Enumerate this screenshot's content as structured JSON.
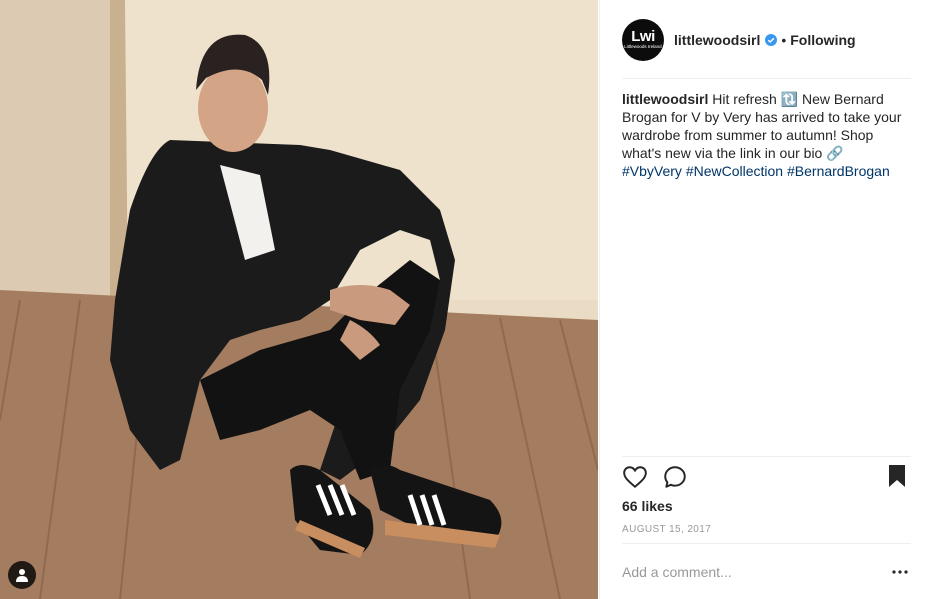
{
  "post": {
    "username": "littlewoodsirl",
    "separator": "•",
    "follow_label": "Following",
    "avatar_text": "Lwi",
    "avatar_subtext": "Littlewoods Ireland",
    "caption_username": "littlewoodsirl",
    "caption_text_1": "Hit refresh",
    "caption_emoji_1": "🔃",
    "caption_text_2": "New Bernard Brogan for V by Very has arrived to take your wardrobe from summer to autumn! Shop what's new via the link in our bio",
    "caption_emoji_2": "🔗",
    "hashtags": [
      "#VbyVery",
      "#NewCollection",
      "#BernardBrogan"
    ],
    "likes": "66 likes",
    "date": "AUGUST 15, 2017",
    "comment_placeholder": "Add a comment...",
    "more_label": "•••"
  },
  "icons": {
    "verified": "verified-badge-icon",
    "like": "heart-icon",
    "comment": "comment-bubble-icon",
    "save": "bookmark-icon",
    "tagged_users": "user-tag-icon"
  },
  "colors": {
    "text": "#262626",
    "muted": "#999999",
    "hashtag": "#003569",
    "verified": "#3897f0",
    "divider": "#efefef"
  }
}
